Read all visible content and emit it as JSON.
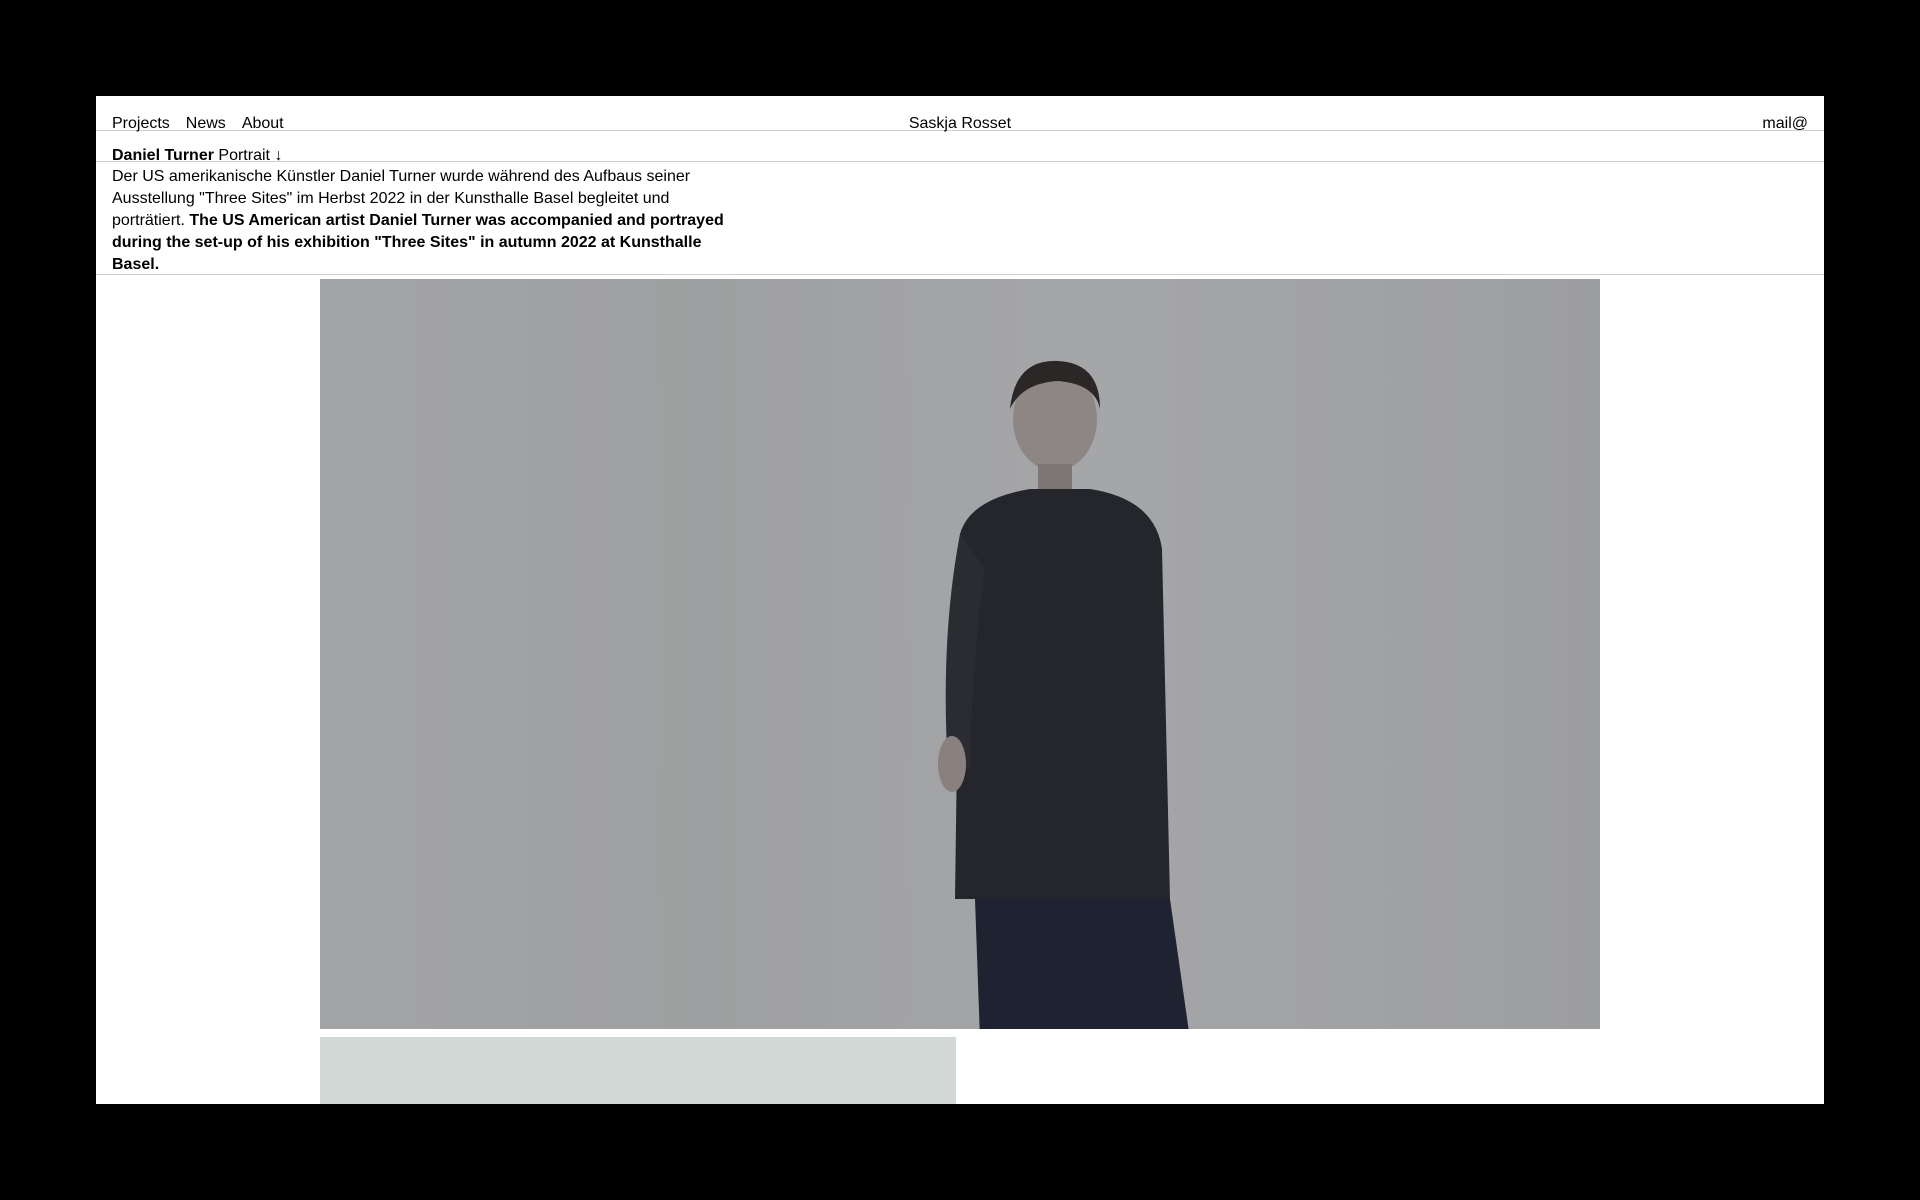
{
  "nav": {
    "links": [
      "Projects",
      "News",
      "About"
    ],
    "site_title": "Saskja Rosset",
    "mail": "mail@"
  },
  "project": {
    "artist": "Daniel Turner",
    "category": "Portrait",
    "arrow": "↓",
    "text_de": "Der US amerikanische Künstler Daniel Turner wurde während des Aufbaus seiner Ausstellung \"Three Sites\" im Herbst 2022 in der Kunsthalle Basel begleitet und porträtiert.",
    "text_en": "The US American artist Daniel Turner was accompanied and portrayed during the set-up of his exhibition \"Three Sites\" in autumn 2022 at Kunsthalle Basel."
  },
  "colors": {
    "background": "#000000",
    "page": "#ffffff",
    "divider": "#cfcfcf",
    "photo_bg": "#a2a3a5",
    "second_photo_bg": "#d1d8d5"
  }
}
